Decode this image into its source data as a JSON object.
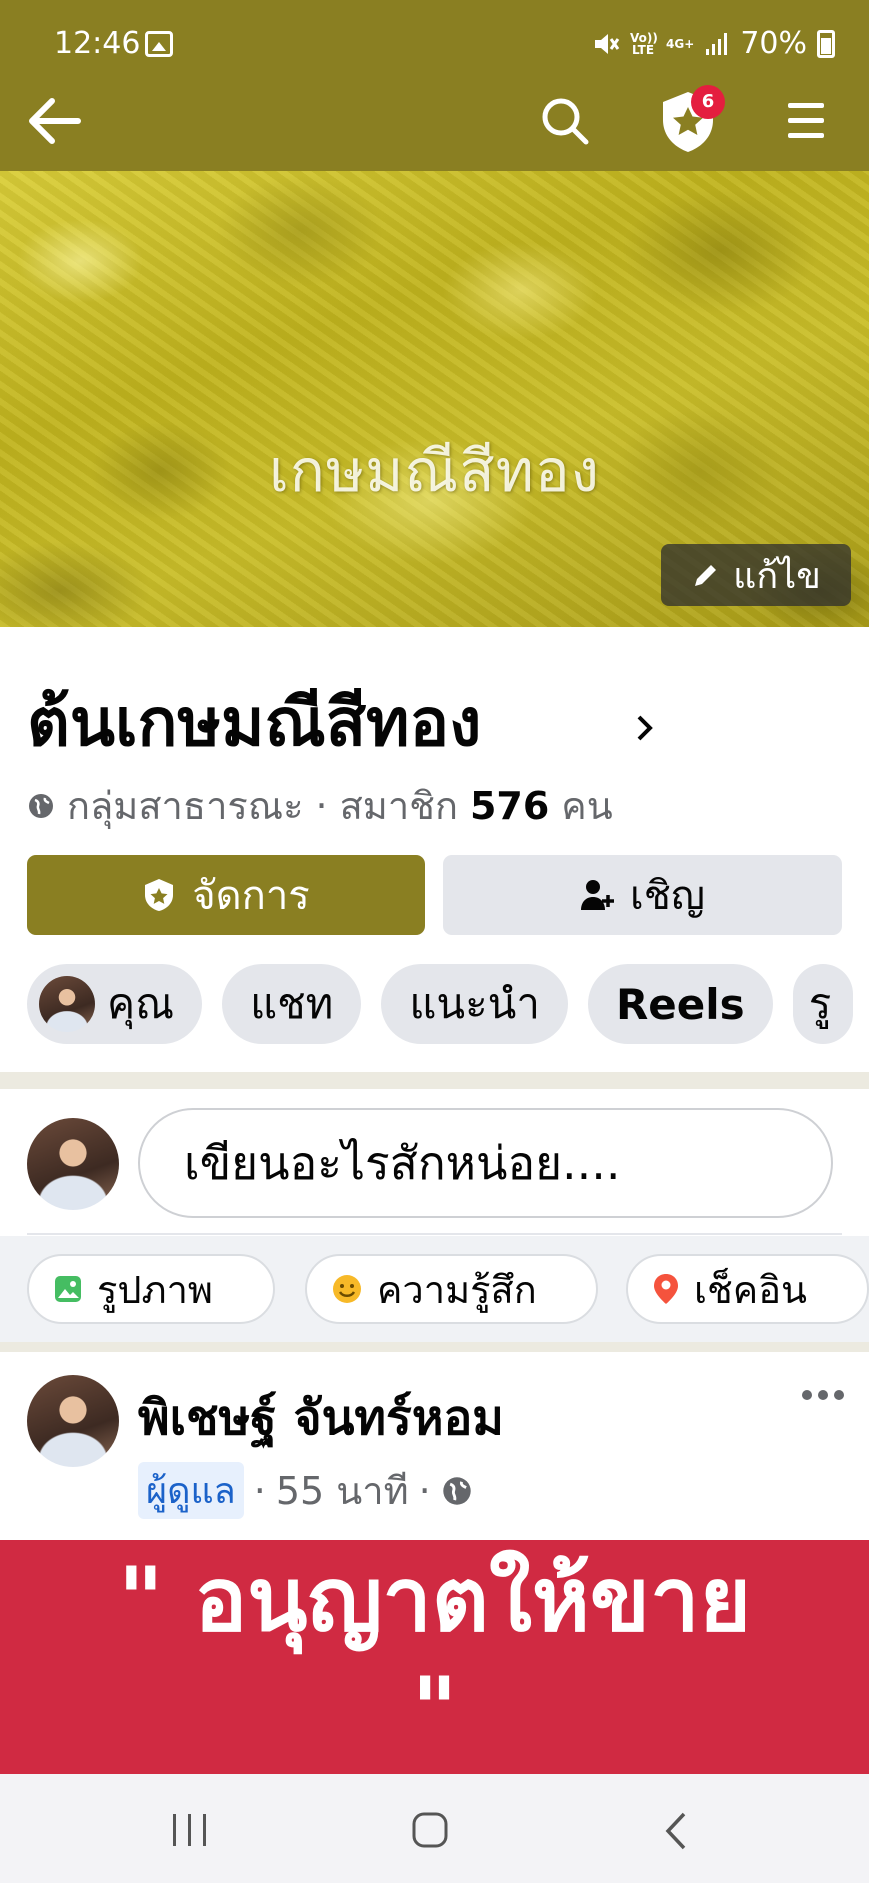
{
  "status_bar": {
    "time": "12:46",
    "network_volte": "Vo)) LTE",
    "network_4g": "4G+",
    "battery": "70%"
  },
  "top_nav": {
    "notification_count": "6",
    "accent_color": "#8a7f22"
  },
  "cover": {
    "overlay_text": "เกษมณีสีทอง",
    "edit_label": "แก้ไข"
  },
  "group": {
    "name": "ต้นเกษมณีสีทอง",
    "privacy": "กลุ่มสาธารณะ",
    "separator": "·",
    "members_label": "สมาชิก",
    "members_count": "576",
    "members_unit": "คน"
  },
  "buttons": {
    "manage": "จัดการ",
    "invite": "เชิญ"
  },
  "chips": [
    {
      "label": "คุณ"
    },
    {
      "label": "แชท"
    },
    {
      "label": "แนะนำ"
    },
    {
      "label": "Reels"
    },
    {
      "label": "รู"
    }
  ],
  "composer": {
    "placeholder": "เขียนอะไรสักหน่อย...."
  },
  "actions": {
    "photo": "รูปภาพ",
    "feeling": "ความรู้สึก",
    "checkin": "เช็คอิน"
  },
  "post": {
    "author": "พิเชษฐ์ จันทร์หอม",
    "role": "ผู้ดูแล",
    "dot": "·",
    "time": "55 นาที",
    "banner_line1": "\" อนุญาตให้ขาย",
    "banner_line2": "\"",
    "banner_color": "#d02a42"
  }
}
